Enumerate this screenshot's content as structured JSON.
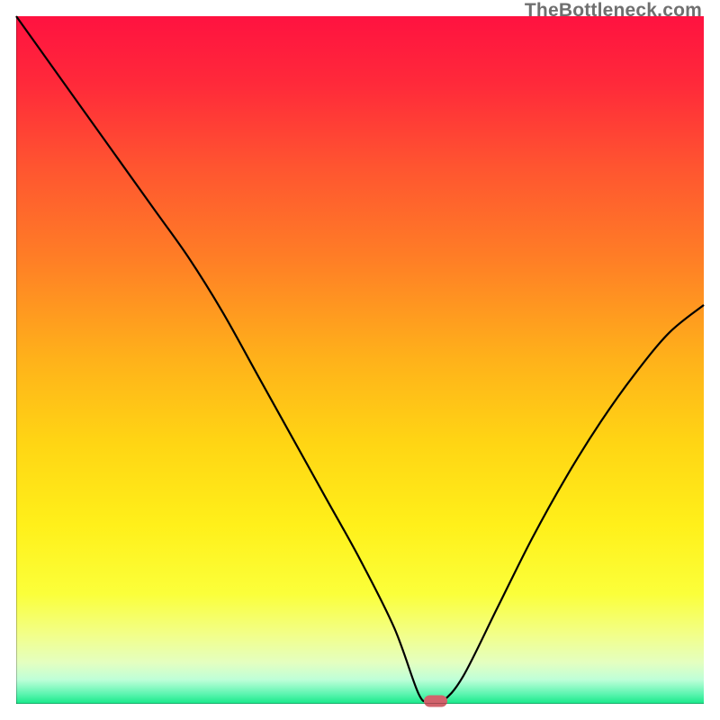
{
  "watermark": "TheBottleneck.com",
  "colors": {
    "axis": "#000000",
    "curve": "#000000",
    "marker": "#d1636c",
    "watermark": "#6f6f6f"
  },
  "chart_data": {
    "type": "line",
    "title": "",
    "xlabel": "",
    "ylabel": "",
    "xlim": [
      0,
      100
    ],
    "ylim": [
      0,
      100
    ],
    "x": [
      0,
      5,
      10,
      15,
      20,
      25,
      30,
      35,
      40,
      45,
      50,
      55,
      58.5,
      60,
      62,
      65,
      70,
      75,
      80,
      85,
      90,
      95,
      100
    ],
    "values": [
      100,
      93,
      86,
      79,
      72,
      65,
      57,
      48,
      39,
      30,
      21,
      11,
      1.5,
      0.4,
      0.4,
      4,
      14,
      24,
      33,
      41,
      48,
      54,
      58
    ],
    "marker": {
      "x": 61,
      "y": 0.4
    },
    "gradient_stops": [
      {
        "offset": 0.0,
        "color": "#ff1240"
      },
      {
        "offset": 0.1,
        "color": "#ff2a3a"
      },
      {
        "offset": 0.22,
        "color": "#ff5530"
      },
      {
        "offset": 0.35,
        "color": "#ff7d26"
      },
      {
        "offset": 0.5,
        "color": "#ffb21a"
      },
      {
        "offset": 0.62,
        "color": "#ffd514"
      },
      {
        "offset": 0.74,
        "color": "#fff01a"
      },
      {
        "offset": 0.84,
        "color": "#fbff3a"
      },
      {
        "offset": 0.9,
        "color": "#f2ff8a"
      },
      {
        "offset": 0.94,
        "color": "#e4ffc0"
      },
      {
        "offset": 0.965,
        "color": "#beffd8"
      },
      {
        "offset": 0.985,
        "color": "#60f5b2"
      },
      {
        "offset": 1.0,
        "color": "#16e989"
      }
    ]
  }
}
